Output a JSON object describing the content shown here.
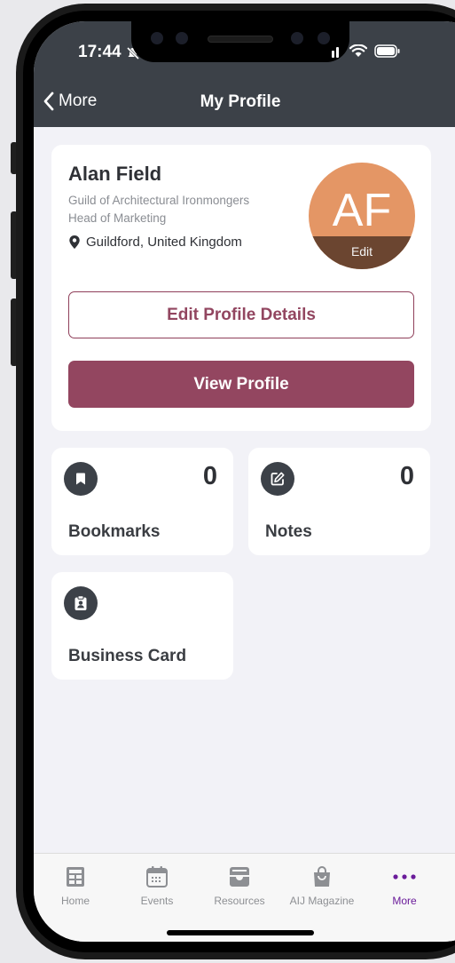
{
  "status_bar": {
    "time": "17:44"
  },
  "nav": {
    "back_label": "More",
    "title": "My Profile"
  },
  "profile": {
    "name": "Alan Field",
    "organization": "Guild of Architectural Ironmongers",
    "role": "Head of Marketing",
    "location": "Guildford, United Kingdom",
    "avatar_initials": "AF",
    "avatar_edit_label": "Edit",
    "edit_button": "Edit Profile Details",
    "view_button": "View Profile"
  },
  "stats": {
    "bookmarks": {
      "label": "Bookmarks",
      "count": "0",
      "icon": "bookmark-icon"
    },
    "notes": {
      "label": "Notes",
      "count": "0",
      "icon": "edit-note-icon"
    },
    "business_card": {
      "label": "Business Card",
      "icon": "id-badge-icon"
    }
  },
  "tabbar": {
    "items": [
      {
        "label": "Home",
        "icon": "home-grid-icon"
      },
      {
        "label": "Events",
        "icon": "calendar-icon"
      },
      {
        "label": "Resources",
        "icon": "tray-icon"
      },
      {
        "label": "AIJ Magazine",
        "icon": "bag-icon"
      },
      {
        "label": "More",
        "icon": "more-dots-icon"
      }
    ],
    "active": "More"
  },
  "colors": {
    "header": "#3c4148",
    "accent": "#934660",
    "avatar": "#e49665",
    "active_tab": "#6a1b9a"
  }
}
